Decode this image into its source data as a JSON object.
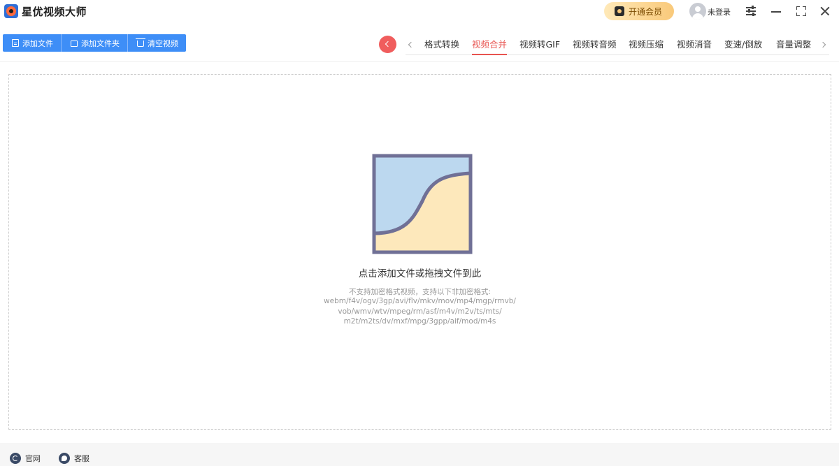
{
  "app": {
    "title": "星优视频大师",
    "logo_icon": "camera-lens-icon"
  },
  "titlebar": {
    "vip_label": "开通会员",
    "login_label": "未登录",
    "colors": {
      "vip_gradient_start": "#ffe9b8",
      "vip_gradient_end": "#f9c97a"
    }
  },
  "toolbar": {
    "add_file_label": "添加文件",
    "add_folder_label": "添加文件夹",
    "clear_label": "清空视频",
    "button_color": "#3e8ef7"
  },
  "tabs": {
    "active_color": "#e8534f",
    "items": [
      {
        "label": "格式转换",
        "active": false
      },
      {
        "label": "视频合并",
        "active": true
      },
      {
        "label": "视频转GIF",
        "active": false
      },
      {
        "label": "视频转音频",
        "active": false
      },
      {
        "label": "视频压缩",
        "active": false
      },
      {
        "label": "视频消音",
        "active": false
      },
      {
        "label": "变速/倒放",
        "active": false
      },
      {
        "label": "音量调整",
        "active": false
      }
    ]
  },
  "drop_area": {
    "title": "点击添加文件或拖拽文件到此",
    "hint_lines": [
      "不支持加密格式视频，支持以下非加密格式:",
      "webm/f4v/ogv/3gp/avi/flv/mkv/mov/mp4/mgp/rmvb/",
      "vob/wmv/wtv/mpeg/rm/asf/m4v/m2v/ts/mts/",
      "m2t/m2ts/dv/mxf/mpg/3gpp/aif/mod/m4s"
    ]
  },
  "footer": {
    "site_label": "官网",
    "service_label": "客服"
  }
}
